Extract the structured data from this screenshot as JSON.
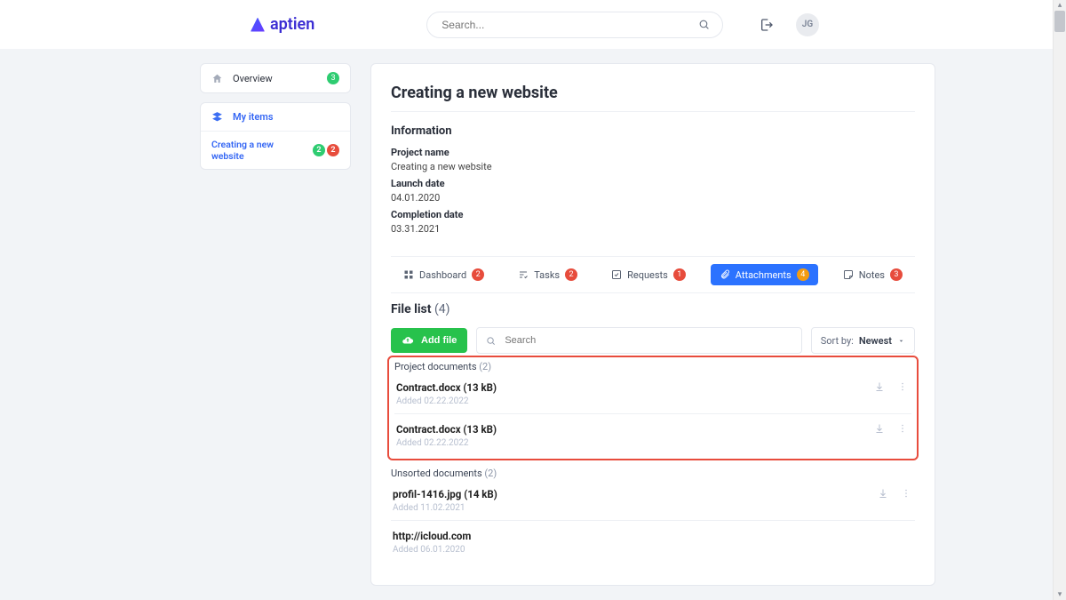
{
  "topbar": {
    "brand": "aptien",
    "search_placeholder": "Search...",
    "avatar_initials": "JG"
  },
  "sidebar": {
    "overview": {
      "label": "Overview",
      "count": "3"
    },
    "my_items": {
      "label": "My items"
    },
    "crumb": {
      "label": "Creating a new website",
      "green_count": "2",
      "red_count": "2"
    }
  },
  "main": {
    "title": "Creating a new website",
    "info_heading": "Information",
    "fields": {
      "project_name_label": "Project name",
      "project_name_value": "Creating a new website",
      "launch_date_label": "Launch date",
      "launch_date_value": "04.01.2020",
      "completion_date_label": "Completion date",
      "completion_date_value": "03.31.2021"
    },
    "tabs": {
      "dashboard": {
        "label": "Dashboard",
        "badge": "2"
      },
      "tasks": {
        "label": "Tasks",
        "badge": "2"
      },
      "requests": {
        "label": "Requests",
        "badge": "1"
      },
      "attachments": {
        "label": "Attachments",
        "badge": "4"
      },
      "notes": {
        "label": "Notes",
        "badge": "3"
      }
    },
    "filelist": {
      "heading": "File list",
      "count_display": "(4)",
      "add_button": "Add file",
      "search_placeholder": "Search",
      "sort_label": "Sort by:",
      "sort_value": "Newest",
      "groups": [
        {
          "name": "Project documents",
          "count": "(2)",
          "files": [
            {
              "name": "Contract.docx (13 kB)",
              "meta": "Added 02.22.2022"
            },
            {
              "name": "Contract.docx (13 kB)",
              "meta": "Added 02.22.2022"
            }
          ]
        },
        {
          "name": "Unsorted documents",
          "count": "(2)",
          "files": [
            {
              "name": "profil-1416.jpg (14 kB)",
              "meta": "Added 11.02.2021"
            },
            {
              "name": "http://icloud.com",
              "meta": "Added 06.01.2020"
            }
          ]
        }
      ]
    }
  }
}
